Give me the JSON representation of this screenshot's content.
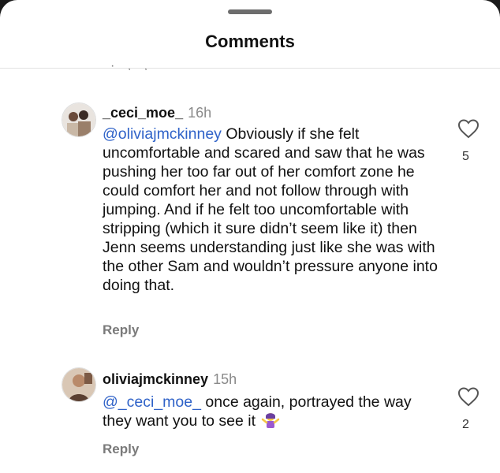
{
  "header": {
    "title": "Comments",
    "partial_line": "· , ,"
  },
  "comments": [
    {
      "username": "_ceci_moe_",
      "time": "16h",
      "mention": "@oliviajmckinney",
      "text": "Obviously if she felt uncomfortable and scared and saw that he was pushing her too far out of her comfort zone he could comfort her and not follow through with jumping. And if he felt too uncomfortable with stripping (which it sure didn’t seem like it) then Jenn seems understanding  just like she was with the other Sam and wouldn’t pressure anyone into doing that.",
      "likes": "5",
      "reply_label": "Reply"
    },
    {
      "username": "oliviajmckinney",
      "time": "15h",
      "mention": "@_ceci_moe_",
      "text": "once again, portrayed the way they want you to see it",
      "emoji": "woman-shrugging-emoji",
      "likes": "2",
      "reply_label": "Reply"
    }
  ],
  "colors": {
    "mention": "#2f62c8",
    "meta_gray": "#8a8a8a",
    "reply_gray": "#7a7a7a"
  }
}
